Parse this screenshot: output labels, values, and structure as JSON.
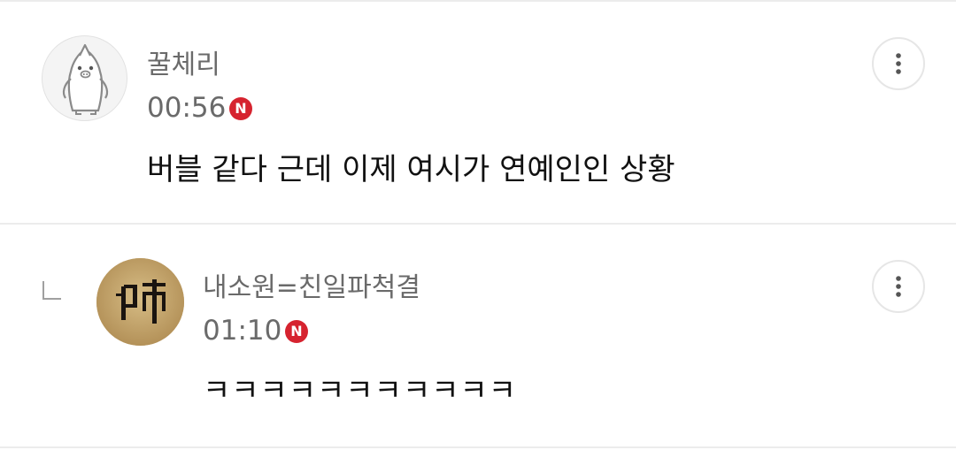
{
  "comments": [
    {
      "author": "꿀체리",
      "time": "00:56",
      "badge": "N",
      "text": "버블 같다 근데 이제 여시가 연예인인 상황",
      "avatar": "penguin-avatar"
    },
    {
      "author": "내소원=친일파척결",
      "time": "01:10",
      "badge": "N",
      "text": "ㅋㅋㅋㅋㅋㅋㅋㅋㅋㅋㅋ",
      "avatar": "calligraphy-avatar",
      "avatar_char": "帥",
      "is_reply": true
    }
  ],
  "icons": {
    "more": "more-vertical-icon",
    "reply": "reply-indent-icon"
  },
  "colors": {
    "badge": "#d6232f",
    "text": "#111111",
    "meta": "#6a6a6a"
  }
}
